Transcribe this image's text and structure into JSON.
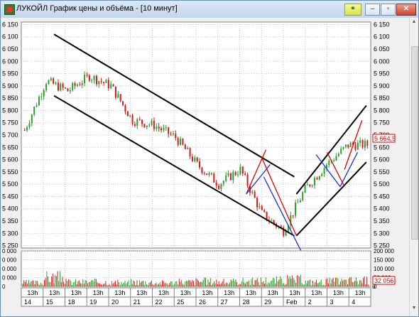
{
  "window": {
    "title": "ЛУКОЙЛ График цены и объёма - [10 минут]",
    "buttons": {
      "minimize": "–",
      "maximize": "▫",
      "close": "✕"
    }
  },
  "price_axis": {
    "ticks": [
      "6 150",
      "6 100",
      "6 050",
      "6 000",
      "5 950",
      "5 900",
      "5 850",
      "5 800",
      "5 750",
      "5 700",
      "5 650",
      "5 600",
      "5 550",
      "5 500",
      "5 450",
      "5 400",
      "5 350",
      "5 300",
      "5 250"
    ],
    "current_price": "5 664,5"
  },
  "volume_axis": {
    "ticks_right": [
      "200 000",
      "150 000",
      "100 000",
      "50 000",
      "0"
    ],
    "ticks_left": [
      "0 000",
      "0 000",
      "0 000",
      "0 000",
      "0"
    ],
    "current_volume": "32 056",
    "unit_mark": "u"
  },
  "time_axis": {
    "hours": [
      "13h",
      "13h",
      "13h",
      "13h",
      "13h",
      "13h",
      "13h",
      "13h",
      "13h",
      "13h",
      "13h",
      "13h",
      "13h",
      "13h",
      "13h",
      "13h"
    ],
    "days": [
      "14",
      "15",
      "18",
      "19",
      "20",
      "21",
      "22",
      "25",
      "26",
      "27",
      "28",
      "29",
      "Feb",
      "2",
      "3",
      "4"
    ]
  },
  "colors": {
    "up": "#2e9b2e",
    "down": "#d01c1c",
    "channel": "#000000",
    "red_line": "#e00000",
    "blue_line": "#1a2fd6"
  },
  "chart_data": {
    "type": "line",
    "title": "ЛУКОЙЛ График цены и объёма - [10 минут]",
    "interval": "10 минут",
    "x": [
      "14",
      "15",
      "18",
      "19",
      "20",
      "21",
      "22",
      "25",
      "26",
      "27",
      "28",
      "29",
      "Feb",
      "2",
      "3",
      "4"
    ],
    "series": [
      {
        "name": "",
        "values": [
          5720,
          5920,
          5880,
          5940,
          5900,
          5760,
          5740,
          5690,
          5580,
          5500,
          5560,
          5380,
          5310,
          5480,
          5580,
          5660
        ]
      }
    ],
    "volume": [
      25000,
      60000,
      30000,
      30000,
      25000,
      30000,
      25000,
      30000,
      35000,
      30000,
      35000,
      40000,
      45000,
      30000,
      35000,
      40000
    ],
    "ylim": [
      5240,
      6160
    ],
    "volume_ylim": [
      0,
      200000
    ],
    "last_price": 5664.5,
    "last_volume": 32056
  }
}
